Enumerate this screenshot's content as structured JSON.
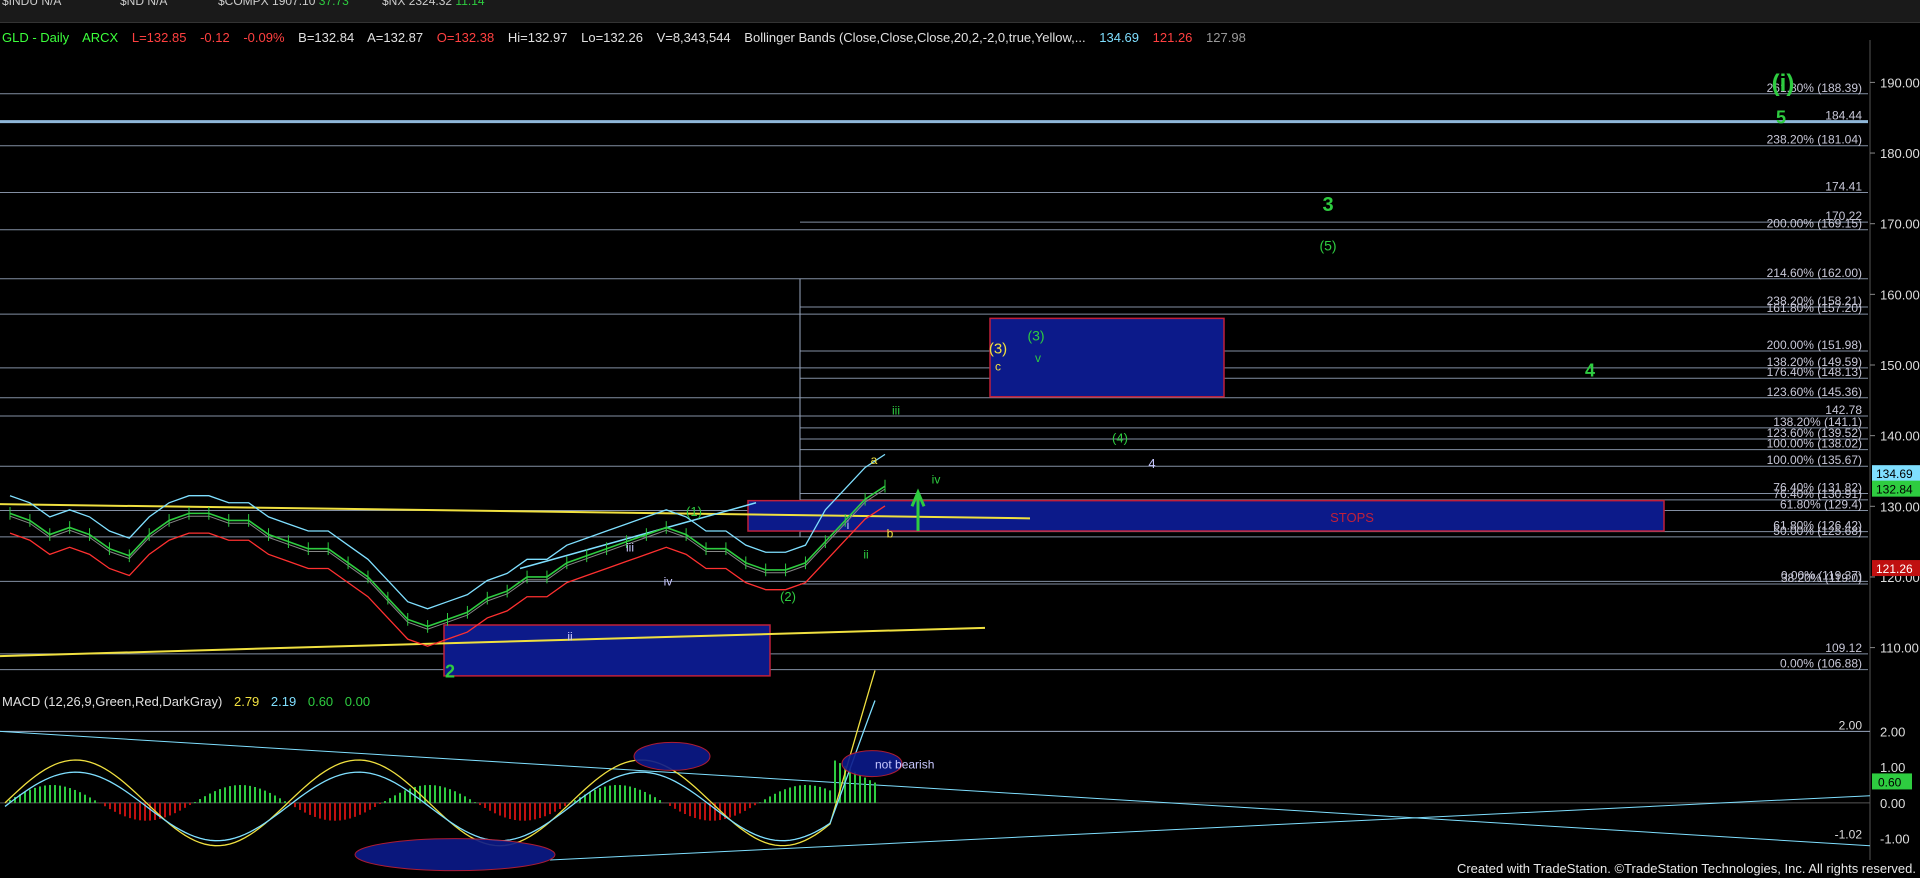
{
  "ticker_bar": [
    {
      "sym": "$INDU",
      "val": "N/A",
      "chg": ""
    },
    {
      "sym": "$ND",
      "val": "N/A",
      "chg": ""
    },
    {
      "sym": "$COMPX",
      "val": "1907.10",
      "chg": "37.73"
    },
    {
      "sym": "$NX",
      "val": "2324.32",
      "chg": "11.14"
    }
  ],
  "header": {
    "symbol": "GLD - Daily",
    "exchange": "ARCX",
    "last": "L=132.85",
    "chg": "-0.12",
    "pct": "-0.09%",
    "bid": "B=132.84",
    "ask": "A=132.87",
    "open": "O=132.38",
    "hi": "Hi=132.97",
    "lo": "Lo=132.26",
    "vol": "V=8,343,544",
    "study": "Bollinger Bands (Close,Close,Close,20,2,-2,0,true,Yellow,...",
    "bb_upper": "134.69",
    "bb_lower": "121.26",
    "bb_mid": "127.98"
  },
  "macd_header": {
    "study": "MACD (12,26,9,Green,Red,DarkGray)",
    "macd": "2.79",
    "signal": "2.19",
    "diff": "0.60",
    "zero": "0.00"
  },
  "footer": "Created with TradeStation. ©TradeStation Technologies, Inc. All rights reserved.",
  "colors": {
    "price_up": "#2ecc40",
    "upper_band": "#7fdfff",
    "lower_band": "#ff3030",
    "mid_band": "#888888",
    "yellow": "#f0e040",
    "zone": "#0c1a8a"
  },
  "chart_data": {
    "type": "line",
    "title": "GLD - Daily",
    "ylim": [
      104,
      196
    ],
    "y_ticks": [
      110,
      120,
      130,
      140,
      150,
      160,
      170,
      180,
      190
    ],
    "last_price": "132.84",
    "upper_band_label": "134.69",
    "lower_band_label": "121.26",
    "series": [
      {
        "name": "GLD",
        "values": [
          129,
          128,
          126,
          127,
          126,
          124,
          123,
          126,
          128,
          129,
          129,
          128,
          128,
          126,
          125,
          124,
          124,
          122,
          120,
          117,
          114,
          113,
          114,
          115,
          117,
          118,
          120,
          120,
          122,
          123,
          124,
          125,
          126,
          127,
          126,
          124,
          124,
          122,
          121,
          121,
          122,
          125,
          128,
          131,
          132.85
        ]
      }
    ],
    "fib_levels": [
      {
        "label": "261.80% (188.39)",
        "value": 188.39
      },
      {
        "label": "184.44",
        "value": 184.44
      },
      {
        "label": "238.20% (181.04)",
        "value": 181.04
      },
      {
        "label": "174.41",
        "value": 174.41
      },
      {
        "label": "170.22",
        "value": 170.22
      },
      {
        "label": "200.00% (169.15)",
        "value": 169.15
      },
      {
        "label": "214.60% (162.00)",
        "value": 162.2
      },
      {
        "label": "238.20% (158.21)",
        "value": 158.21
      },
      {
        "label": "161.80% (157.20)",
        "value": 157.2
      },
      {
        "label": "200.00% (151.98)",
        "value": 151.98
      },
      {
        "label": "138.20% (149.59)",
        "value": 149.59
      },
      {
        "label": "176.40% (148.13)",
        "value": 148.13
      },
      {
        "label": "123.60% (145.36)",
        "value": 145.36
      },
      {
        "label": "142.78",
        "value": 142.78
      },
      {
        "label": "138.20% (141.1)",
        "value": 141.1
      },
      {
        "label": "123.60% (139.52)",
        "value": 139.52
      },
      {
        "label": "100.00% (138.02)",
        "value": 138.02
      },
      {
        "label": "100.00% (135.67)",
        "value": 135.67
      },
      {
        "label": "76.40% (131.82)",
        "value": 131.82
      },
      {
        "label": "76.40% (130.91)",
        "value": 130.91
      },
      {
        "label": "61.80% (129.4)",
        "value": 129.4
      },
      {
        "label": "61.80% (126.42)",
        "value": 126.42
      },
      {
        "label": "50.00% (125.68)",
        "value": 125.68
      },
      {
        "label": "0.00% (119.37)",
        "value": 119.37
      },
      {
        "label": "38.20% (119.0)",
        "value": 119.0
      },
      {
        "label": "109.12",
        "value": 109.12
      },
      {
        "label": "0.00% (106.88)",
        "value": 106.88
      }
    ],
    "annotations": [
      "(i)",
      "5",
      "3",
      "(5)",
      "(3)",
      "c",
      "v",
      "(3)",
      "4",
      "iii",
      "(4)",
      "a",
      "iv",
      "4",
      "i",
      "ii",
      "b",
      "(1)",
      "iii",
      "iv",
      "(2)",
      "ii",
      "2",
      "STOPS",
      "not bearish"
    ],
    "macd": {
      "ylim": [
        -1.6,
        2.6
      ],
      "y_ticks": [
        "2.00",
        "1.00",
        "0.00",
        "-1.00"
      ],
      "tick_labels": [
        "2.00",
        "1.00",
        "0.60",
        "0.00",
        "-1.02"
      ]
    }
  }
}
